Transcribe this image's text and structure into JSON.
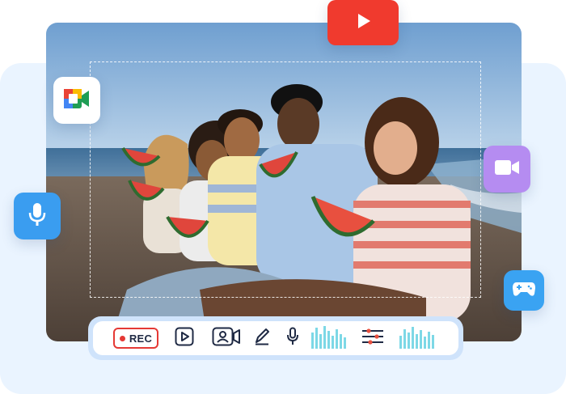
{
  "toolbar": {
    "rec_label": "REC",
    "tools": [
      "play-icon",
      "webcam-icon",
      "pen-icon",
      "microphone-icon",
      "audio-levels-icon",
      "settings-sliders-icon",
      "audio-levels-icon"
    ]
  },
  "floating_apps": [
    "youtube-icon",
    "google-meet-icon",
    "microphone-icon",
    "video-camera-icon",
    "gamepad-icon"
  ],
  "colors": {
    "background_panel": "#eaf4ff",
    "youtube_red": "#f03a2e",
    "mic_blue": "#3a9df0",
    "camera_purple": "#b58cf1",
    "gamepad_blue": "#3aa3f2",
    "rec_red": "#e53935",
    "toolbar_navy": "#1f2a44",
    "level_cyan": "#7dd8e6"
  }
}
